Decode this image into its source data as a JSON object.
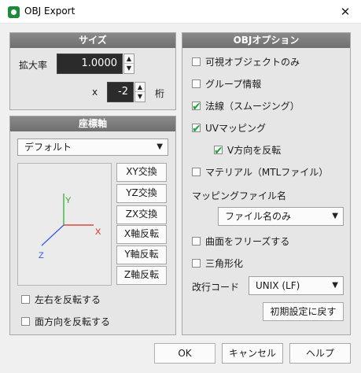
{
  "window": {
    "title": "OBJ Export",
    "close_glyph": "✕"
  },
  "size_panel": {
    "header": "サイズ",
    "scale_label": "拡大率",
    "scale_value": "1.0000",
    "x_label": "x",
    "digits_value": "-2",
    "digits_label": "桁"
  },
  "coord_panel": {
    "header": "座標軸",
    "preset": "デフォルト",
    "axis_labels": {
      "y": "Y",
      "x": "X",
      "z": "Z"
    },
    "axis_colors": {
      "y": "#22aa22",
      "x": "#dd2222",
      "z": "#3355ee"
    },
    "buttons": [
      "XY交換",
      "YZ交換",
      "ZX交換",
      "X軸反転",
      "Y軸反転",
      "Z軸反転"
    ],
    "checks": [
      {
        "label": "左右を反転する",
        "checked": false
      },
      {
        "label": "面方向を反転する",
        "checked": false
      }
    ]
  },
  "obj_panel": {
    "header": "OBJオプション",
    "checks": [
      {
        "label": "可視オブジェクトのみ",
        "checked": false
      },
      {
        "label": "グループ情報",
        "checked": false
      },
      {
        "label": "法線（スムージング）",
        "checked": true
      },
      {
        "label": "UVマッピング",
        "checked": true
      },
      {
        "label": "V方向を反転",
        "checked": true
      },
      {
        "label": "マテリアル（MTLファイル）",
        "checked": false
      }
    ],
    "mapping_label": "マッピングファイル名",
    "mapping_value": "ファイル名のみ",
    "checks2": [
      {
        "label": "曲面をフリーズする",
        "checked": false
      },
      {
        "label": "三角形化",
        "checked": false
      }
    ],
    "newline_label": "改行コード",
    "newline_value": "UNIX (LF)",
    "reset_button": "初期設定に戻す"
  },
  "footer": {
    "ok": "OK",
    "cancel": "キャンセル",
    "help": "ヘルプ"
  },
  "colors": {
    "check_tick": "#1aa33a",
    "panel_header": "#7a7a7a"
  },
  "icons": {
    "app": "app-icon",
    "close": "close-icon",
    "spin_up": "▲",
    "spin_down": "▼",
    "caret": "▼",
    "tick": "✔"
  }
}
